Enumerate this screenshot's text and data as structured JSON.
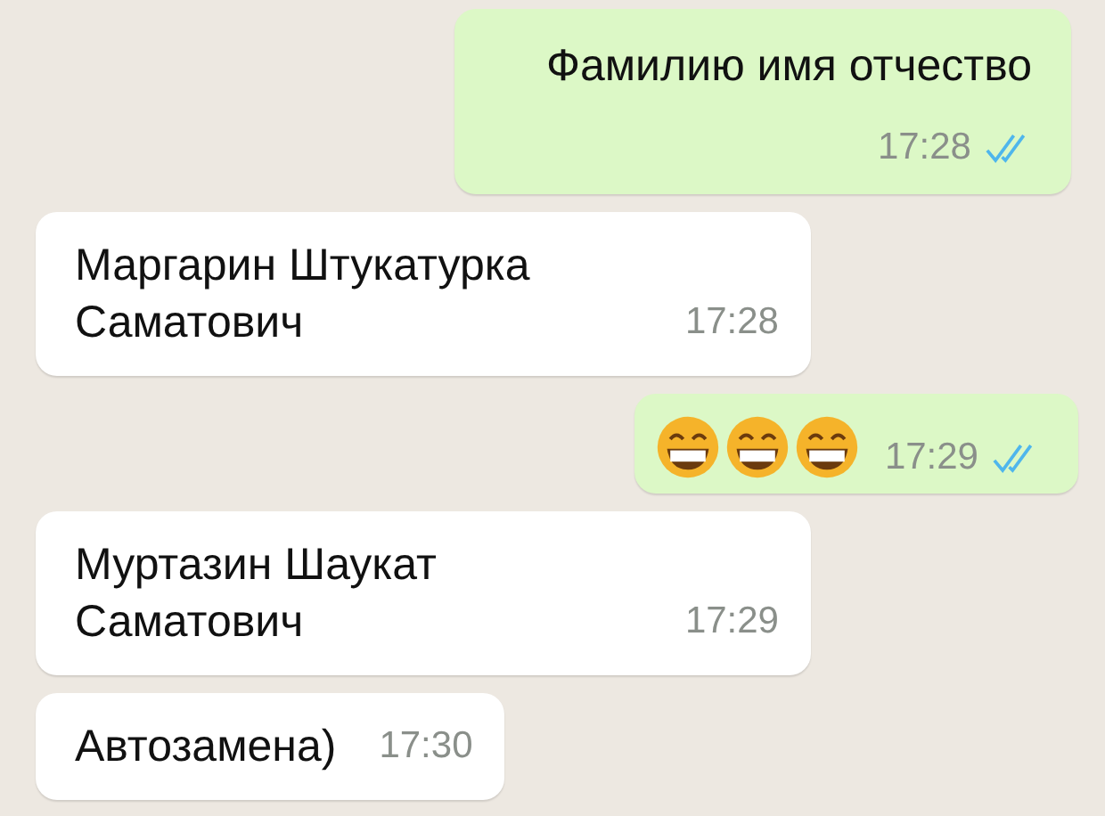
{
  "messages": [
    {
      "kind": "text",
      "outgoing": true,
      "lines": [
        "Фамилию имя отчество"
      ],
      "time": "17:28",
      "read": true
    },
    {
      "kind": "text",
      "outgoing": false,
      "lines": [
        "Маргарин Штукатурка",
        "Саматович"
      ],
      "time": "17:28"
    },
    {
      "kind": "emoji",
      "outgoing": true,
      "emojis": [
        {
          "kind": "grin"
        },
        {
          "kind": "grin"
        },
        {
          "kind": "grin"
        }
      ],
      "time": "17:29",
      "read": true
    },
    {
      "kind": "text",
      "outgoing": false,
      "lines": [
        "Муртазин Шаукат",
        "Саматович"
      ],
      "time": "17:29"
    },
    {
      "kind": "text",
      "outgoing": false,
      "lines": [
        "Автозамена)"
      ],
      "time": "17:30"
    }
  ]
}
